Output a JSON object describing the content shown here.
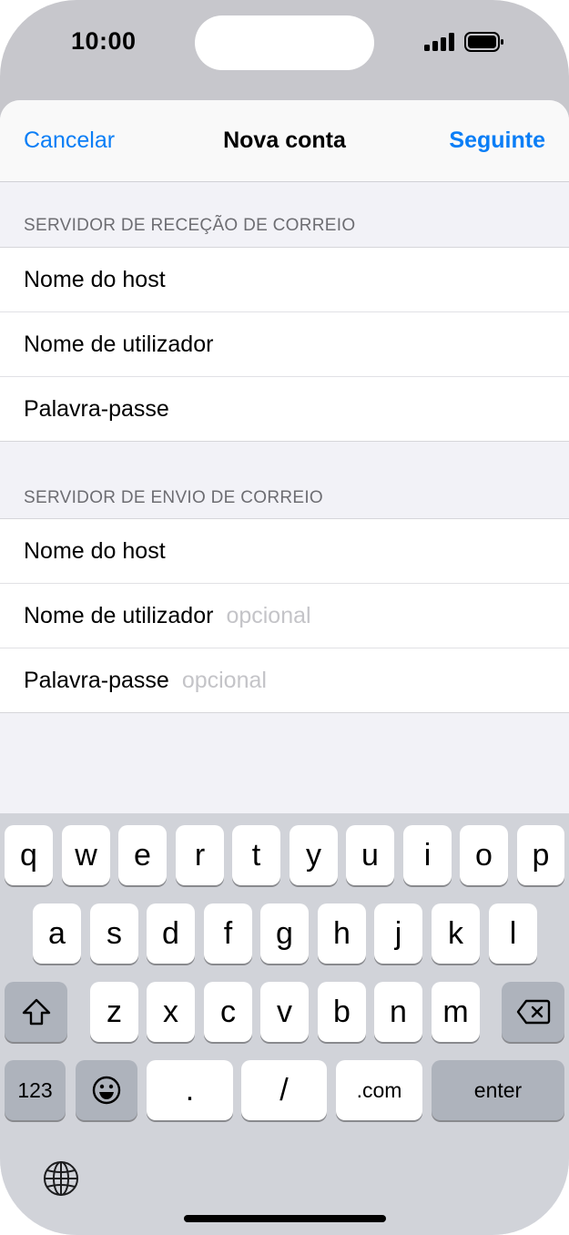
{
  "status_bar": {
    "time": "10:00"
  },
  "nav": {
    "cancel": "Cancelar",
    "title": "Nova conta",
    "next": "Seguinte"
  },
  "incoming": {
    "header": "SERVIDOR DE RECEÇÃO DE CORREIO",
    "rows": [
      {
        "label": "Nome do host",
        "placeholder": ""
      },
      {
        "label": "Nome de utilizador",
        "placeholder": ""
      },
      {
        "label": "Palavra-passe",
        "placeholder": ""
      }
    ]
  },
  "outgoing": {
    "header": "SERVIDOR DE ENVIO DE CORREIO",
    "rows": [
      {
        "label": "Nome do host",
        "placeholder": ""
      },
      {
        "label": "Nome de utilizador",
        "placeholder": "opcional"
      },
      {
        "label": "Palavra-passe",
        "placeholder": "opcional"
      }
    ]
  },
  "keyboard": {
    "row1": [
      "q",
      "w",
      "e",
      "r",
      "t",
      "y",
      "u",
      "i",
      "o",
      "p"
    ],
    "row2": [
      "a",
      "s",
      "d",
      "f",
      "g",
      "h",
      "j",
      "k",
      "l"
    ],
    "row3": [
      "z",
      "x",
      "c",
      "v",
      "b",
      "n",
      "m"
    ],
    "numbers": "123",
    "period": ".",
    "slash": "/",
    "dotcom": ".com",
    "enter": "enter",
    "icons": {
      "shift": "shift-icon",
      "delete": "delete-icon",
      "emoji": "emoji-icon",
      "globe": "globe-icon"
    }
  },
  "colors": {
    "accent": "#0a7ef6",
    "placeholder": "#c4c4c8",
    "sheet_bg": "#f2f2f7",
    "keyboard_bg": "#d1d3d9"
  }
}
